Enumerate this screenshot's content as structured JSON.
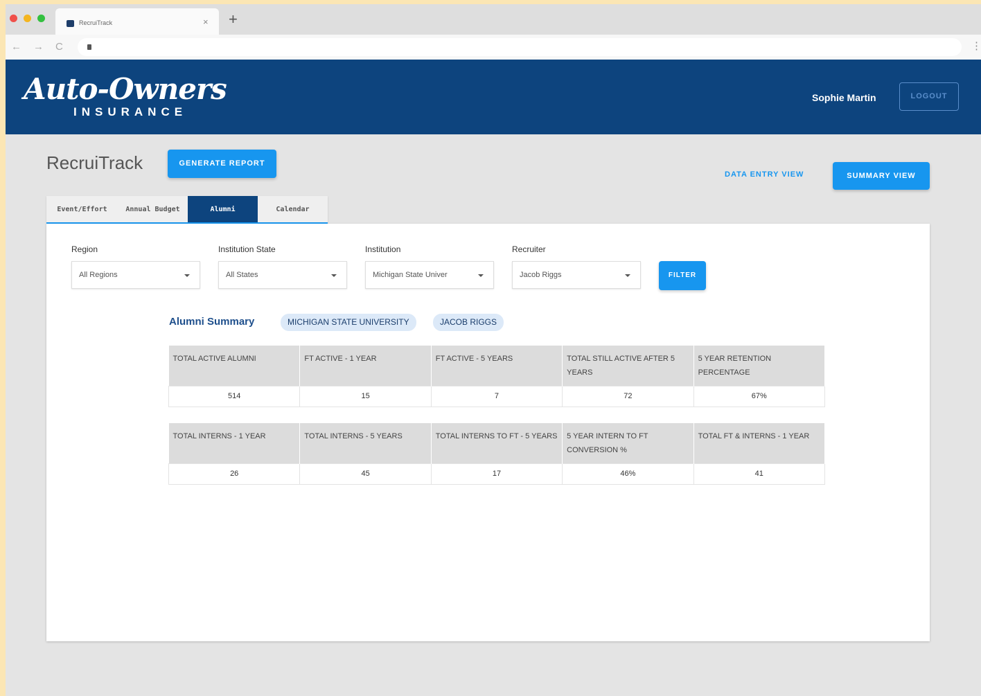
{
  "browser": {
    "tab_title": "RecruiTrack",
    "tab_close": "×",
    "new_tab": "+",
    "back": "←",
    "forward": "→",
    "reload": "C",
    "menu": "⋮"
  },
  "header": {
    "logo_main": "Auto-Owners",
    "logo_sub": "INSURANCE",
    "user_name": "Sophie Martin",
    "logout_label": "LOGOUT",
    "bg_color": "#0d447e"
  },
  "page": {
    "title": "RecruiTrack",
    "generate_report_label": "GENERATE REPORT",
    "data_entry_view_label": "DATA ENTRY VIEW",
    "summary_view_label": "SUMMARY VIEW",
    "accent_color": "#1796ef"
  },
  "tabs": [
    {
      "label": "Event/Effort",
      "active": false
    },
    {
      "label": "Annual Budget",
      "active": false
    },
    {
      "label": "Alumni",
      "active": true
    },
    {
      "label": "Calendar",
      "active": false
    }
  ],
  "filters": {
    "region": {
      "label": "Region",
      "value": "All Regions"
    },
    "state": {
      "label": "Institution State",
      "value": "All States"
    },
    "institution": {
      "label": "Institution",
      "value": "Michigan State Univer"
    },
    "recruiter": {
      "label": "Recruiter",
      "value": "Jacob Riggs"
    },
    "filter_label": "FILTER"
  },
  "summary": {
    "title": "Alumni Summary",
    "chips": [
      "MICHIGAN STATE UNIVERSITY",
      "JACOB RIGGS"
    ]
  },
  "table1": {
    "headers": [
      "TOTAL ACTIVE ALUMNI",
      "FT ACTIVE - 1 YEAR",
      "FT ACTIVE - 5 YEARS",
      "TOTAL STILL ACTIVE AFTER 5 YEARS",
      "5 YEAR RETENTION PERCENTAGE"
    ],
    "values": [
      "514",
      "15",
      "7",
      "72",
      "67%"
    ]
  },
  "table2": {
    "headers": [
      "TOTAL INTERNS - 1 YEAR",
      "TOTAL INTERNS - 5 YEARS",
      "TOTAL INTERNS TO FT - 5 YEARS",
      "5 YEAR INTERN TO FT CONVERSION %",
      "TOTAL FT & INTERNS - 1 YEAR"
    ],
    "values": [
      "26",
      "45",
      "17",
      "46%",
      "41"
    ]
  }
}
